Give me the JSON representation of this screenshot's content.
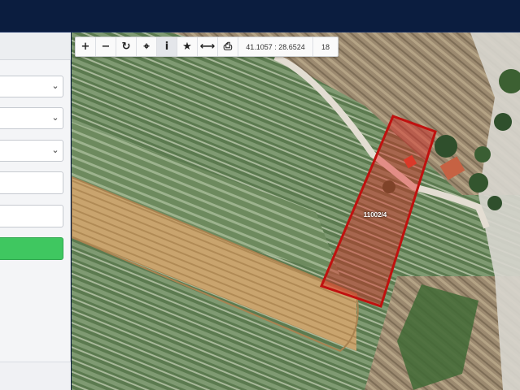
{
  "toolbar": {
    "buttons": [
      {
        "name": "zoom-in",
        "glyph": "+"
      },
      {
        "name": "zoom-out",
        "glyph": "−"
      },
      {
        "name": "refresh",
        "glyph": "↻"
      },
      {
        "name": "locate",
        "glyph": "⌖"
      },
      {
        "name": "info",
        "glyph": "i"
      },
      {
        "name": "favorite",
        "glyph": "★"
      },
      {
        "name": "measure",
        "glyph": "⟷"
      },
      {
        "name": "print",
        "glyph": "⎙"
      }
    ],
    "coordinates": "41.1057 : 28.6524",
    "zoom": "18"
  },
  "map": {
    "parcel_label": "11002/4",
    "parcel_color": "#e0201c"
  },
  "sidebar": {
    "accent_button_color": "#3fc760"
  }
}
